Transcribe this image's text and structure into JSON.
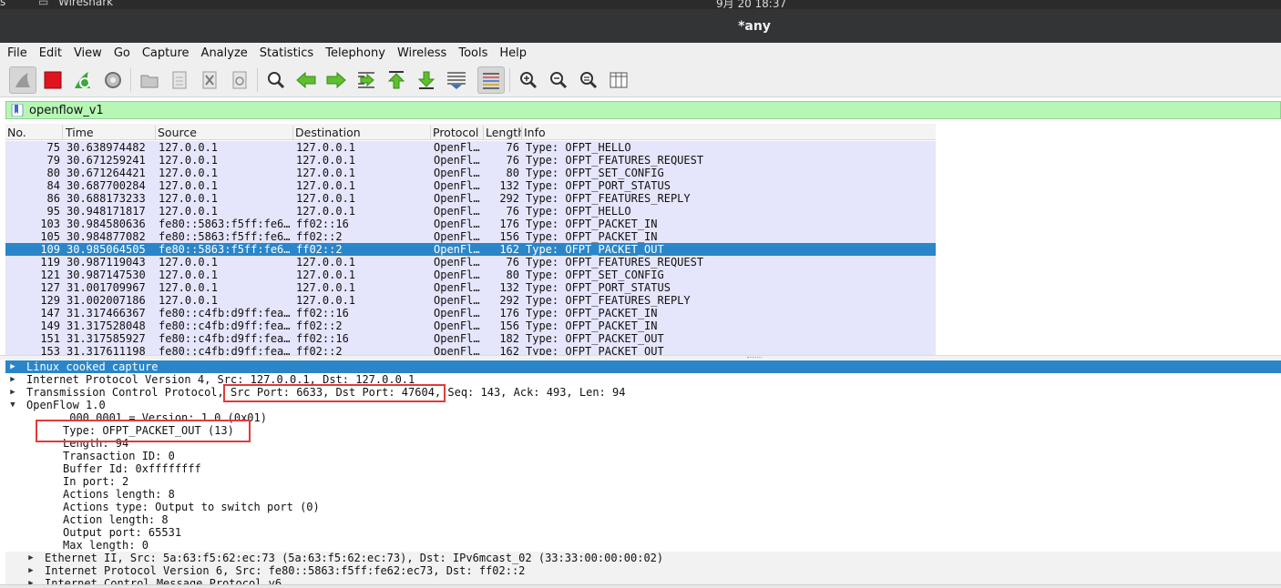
{
  "os_bar": {
    "left_text": "s",
    "app_label": "Wireshark",
    "clock": "9月 20  18:37"
  },
  "window": {
    "title": "*any"
  },
  "menu": [
    "File",
    "Edit",
    "View",
    "Go",
    "Capture",
    "Analyze",
    "Statistics",
    "Telephony",
    "Wireless",
    "Tools",
    "Help"
  ],
  "toolbar": {
    "icons": [
      "shark-fin-start-icon",
      "stop-capture-icon",
      "restart-capture-icon",
      "capture-options-icon",
      "open-file-icon",
      "save-file-icon",
      "close-file-icon",
      "reload-file-icon",
      "find-packet-icon",
      "go-back-icon",
      "go-forward-icon",
      "go-to-packet-icon",
      "go-first-icon",
      "go-last-icon",
      "autoscroll-icon",
      "colorize-icon",
      "zoom-in-icon",
      "zoom-out-icon",
      "zoom-normal-icon",
      "resize-columns-icon"
    ]
  },
  "filter": {
    "value": "openflow_v1"
  },
  "packet_list": {
    "columns": [
      "No.",
      "Time",
      "Source",
      "Destination",
      "Protocol",
      "Length",
      "Info"
    ],
    "rows": [
      {
        "no": "75",
        "time": "30.638974482",
        "src": "127.0.0.1",
        "dst": "127.0.0.1",
        "proto": "OpenFl…",
        "len": "76",
        "info": "Type: OFPT_HELLO"
      },
      {
        "no": "79",
        "time": "30.671259241",
        "src": "127.0.0.1",
        "dst": "127.0.0.1",
        "proto": "OpenFl…",
        "len": "76",
        "info": "Type: OFPT_FEATURES_REQUEST"
      },
      {
        "no": "80",
        "time": "30.671264421",
        "src": "127.0.0.1",
        "dst": "127.0.0.1",
        "proto": "OpenFl…",
        "len": "80",
        "info": "Type: OFPT_SET_CONFIG"
      },
      {
        "no": "84",
        "time": "30.687700284",
        "src": "127.0.0.1",
        "dst": "127.0.0.1",
        "proto": "OpenFl…",
        "len": "132",
        "info": "Type: OFPT_PORT_STATUS"
      },
      {
        "no": "86",
        "time": "30.688173233",
        "src": "127.0.0.1",
        "dst": "127.0.0.1",
        "proto": "OpenFl…",
        "len": "292",
        "info": "Type: OFPT_FEATURES_REPLY"
      },
      {
        "no": "95",
        "time": "30.948171817",
        "src": "127.0.0.1",
        "dst": "127.0.0.1",
        "proto": "OpenFl…",
        "len": "76",
        "info": "Type: OFPT_HELLO"
      },
      {
        "no": "103",
        "time": "30.984580636",
        "src": "fe80::5863:f5ff:fe6…",
        "dst": "ff02::16",
        "proto": "OpenFl…",
        "len": "176",
        "info": "Type: OFPT_PACKET_IN"
      },
      {
        "no": "105",
        "time": "30.984877082",
        "src": "fe80::5863:f5ff:fe6…",
        "dst": "ff02::2",
        "proto": "OpenFl…",
        "len": "156",
        "info": "Type: OFPT_PACKET_IN"
      },
      {
        "no": "109",
        "time": "30.985064505",
        "src": "fe80::5863:f5ff:fe6…",
        "dst": "ff02::2",
        "proto": "OpenFl…",
        "len": "162",
        "info": "Type: OFPT_PACKET_OUT",
        "selected": true
      },
      {
        "no": "119",
        "time": "30.987119043",
        "src": "127.0.0.1",
        "dst": "127.0.0.1",
        "proto": "OpenFl…",
        "len": "76",
        "info": "Type: OFPT_FEATURES_REQUEST"
      },
      {
        "no": "121",
        "time": "30.987147530",
        "src": "127.0.0.1",
        "dst": "127.0.0.1",
        "proto": "OpenFl…",
        "len": "80",
        "info": "Type: OFPT_SET_CONFIG"
      },
      {
        "no": "127",
        "time": "31.001709967",
        "src": "127.0.0.1",
        "dst": "127.0.0.1",
        "proto": "OpenFl…",
        "len": "132",
        "info": "Type: OFPT_PORT_STATUS"
      },
      {
        "no": "129",
        "time": "31.002007186",
        "src": "127.0.0.1",
        "dst": "127.0.0.1",
        "proto": "OpenFl…",
        "len": "292",
        "info": "Type: OFPT_FEATURES_REPLY"
      },
      {
        "no": "147",
        "time": "31.317466367",
        "src": "fe80::c4fb:d9ff:fea…",
        "dst": "ff02::16",
        "proto": "OpenFl…",
        "len": "176",
        "info": "Type: OFPT_PACKET_IN"
      },
      {
        "no": "149",
        "time": "31.317528048",
        "src": "fe80::c4fb:d9ff:fea…",
        "dst": "ff02::2",
        "proto": "OpenFl…",
        "len": "156",
        "info": "Type: OFPT_PACKET_IN"
      },
      {
        "no": "151",
        "time": "31.317585927",
        "src": "fe80::c4fb:d9ff:fea…",
        "dst": "ff02::16",
        "proto": "OpenFl…",
        "len": "182",
        "info": "Type: OFPT_PACKET_OUT"
      },
      {
        "no": "153",
        "time": "31.317611198",
        "src": "fe80::c4fb:d9ff:fea…",
        "dst": "ff02::2",
        "proto": "OpenFl…",
        "len": "162",
        "info": "Type: OFPT_PACKET_OUT"
      }
    ]
  },
  "details": [
    {
      "text": "Linux cooked capture",
      "expand": "collapsed",
      "selected": true
    },
    {
      "text": "Internet Protocol Version 4, Src: 127.0.0.1, Dst: 127.0.0.1",
      "expand": "collapsed"
    },
    {
      "text": "Transmission Control Protocol, Src Port: 6633, Dst Port: 47604, Seq: 143, Ack: 493, Len: 94",
      "expand": "collapsed"
    },
    {
      "text": "OpenFlow 1.0",
      "expand": "expanded"
    },
    {
      "text": ".000 0001 = Version: 1.0 (0x01)",
      "expand": "none"
    },
    {
      "text": "Type: OFPT_PACKET_OUT (13)",
      "expand": "none"
    },
    {
      "text": "Length: 94",
      "expand": "none"
    },
    {
      "text": "Transaction ID: 0",
      "expand": "none"
    },
    {
      "text": "Buffer Id: 0xffffffff",
      "expand": "none"
    },
    {
      "text": "In port: 2",
      "expand": "none"
    },
    {
      "text": "Actions length: 8",
      "expand": "none"
    },
    {
      "text": "Actions type: Output to switch port (0)",
      "expand": "none"
    },
    {
      "text": "Action length: 8",
      "expand": "none"
    },
    {
      "text": "Output port: 65531",
      "expand": "none"
    },
    {
      "text": "Max length: 0",
      "expand": "none"
    },
    {
      "text": "Ethernet II, Src: 5a:63:f5:62:ec:73 (5a:63:f5:62:ec:73), Dst: IPv6mcast_02 (33:33:00:00:00:02)",
      "expand": "collapsed"
    },
    {
      "text": "Internet Protocol Version 6, Src: fe80::5863:f5ff:fe62:ec73, Dst: ff02::2",
      "expand": "collapsed"
    },
    {
      "text": "Internet Control Message Protocol v6",
      "expand": "collapsed"
    }
  ],
  "colors": {
    "selected": "#2a86c9",
    "row_bg": "#e5e5fb",
    "filter_bg": "#b6f7b6",
    "annotation": "#e03a3a"
  }
}
